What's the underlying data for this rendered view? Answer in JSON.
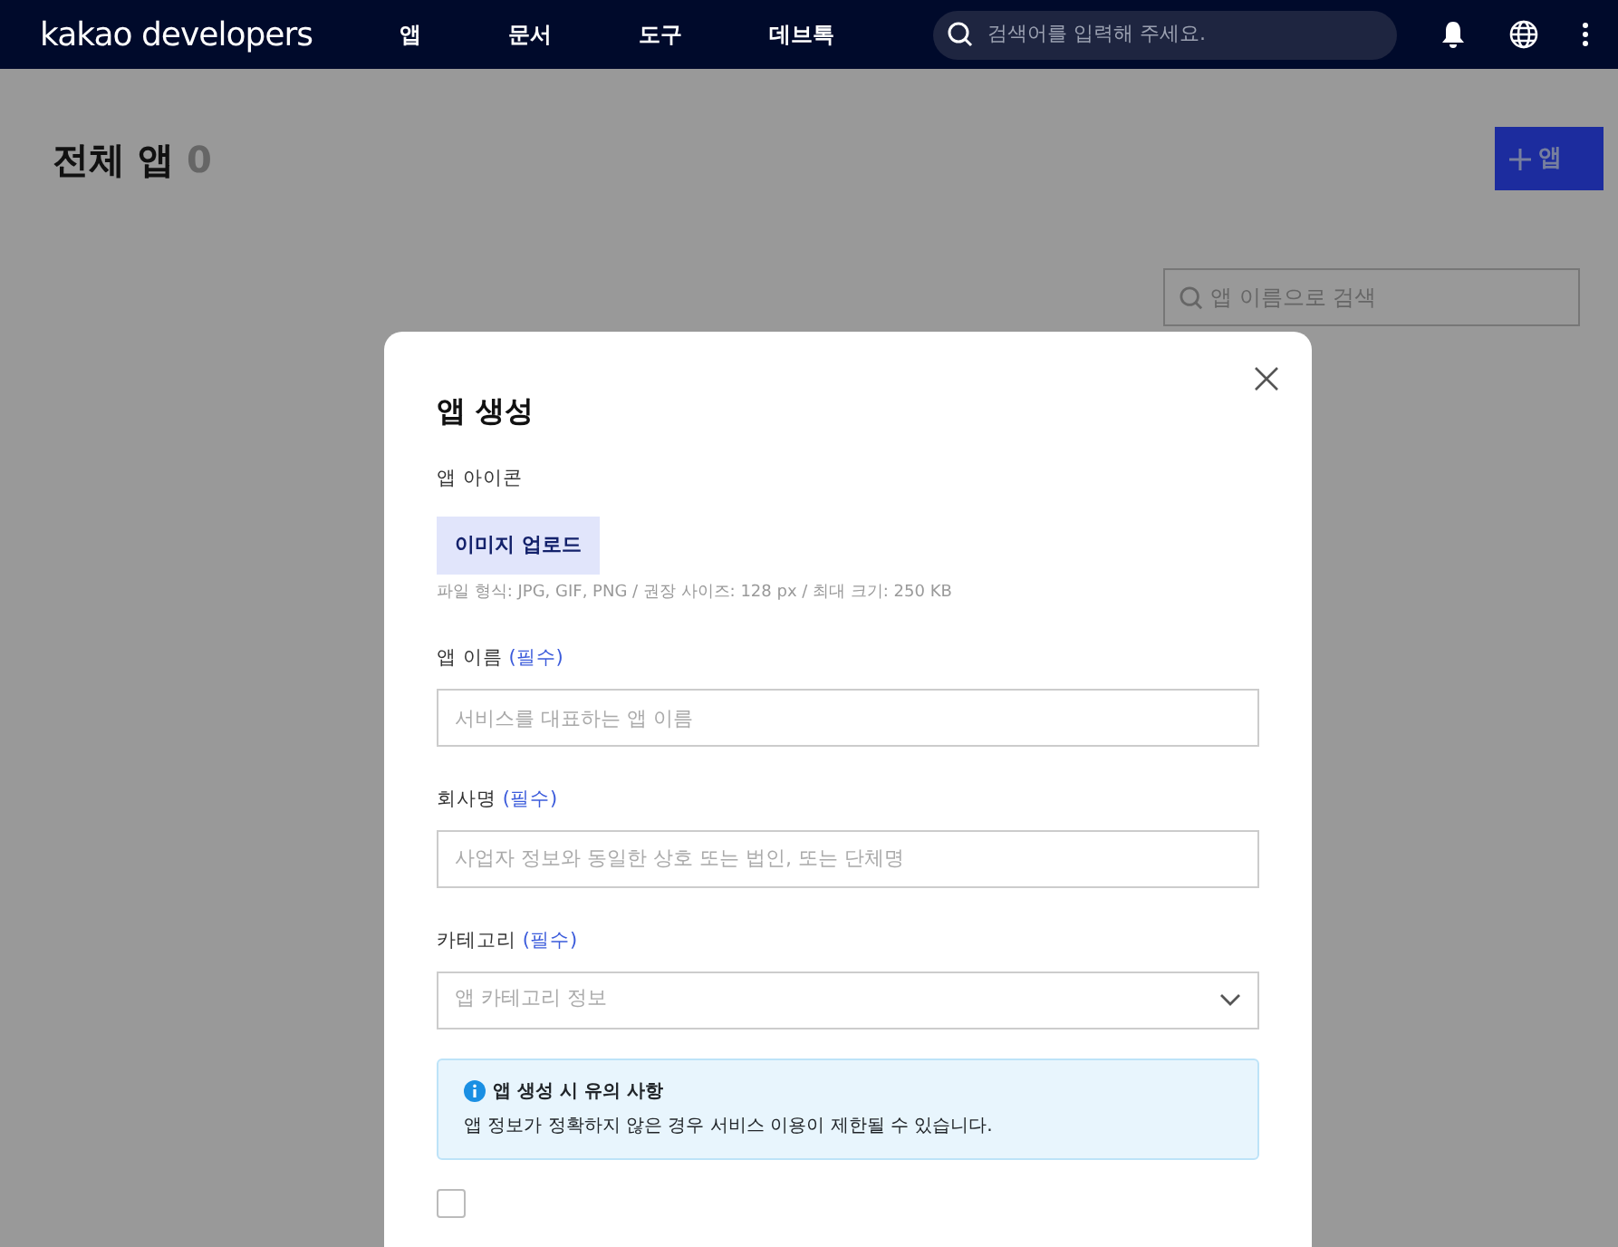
{
  "navbar": {
    "logo": "kakao developers",
    "menu": [
      {
        "label": "앱"
      },
      {
        "label": "문서"
      },
      {
        "label": "도구"
      },
      {
        "label": "데브톡"
      }
    ],
    "search": {
      "placeholder": "검색어를 입력해 주세요."
    }
  },
  "page": {
    "title": "전체 앱",
    "count": "0",
    "create_button": "앱",
    "search": {
      "placeholder": "앱 이름으로 검색"
    }
  },
  "modal": {
    "title": "앱 생성",
    "icon_label": "앱 아이콘",
    "upload_button": "이미지 업로드",
    "upload_hint": "파일 형식: JPG, GIF, PNG / 권장 사이즈: 128 px / 최대 크기: 250 KB",
    "fields": [
      {
        "kind": "text",
        "label": "앱 이름",
        "required": "(필수)",
        "placeholder": "서비스를 대표하는 앱 이름"
      },
      {
        "kind": "text",
        "label": "회사명",
        "required": "(필수)",
        "placeholder": "사업자 정보와 동일한 상호 또는 법인, 또는 단체명"
      },
      {
        "kind": "select",
        "label": "카테고리",
        "required": "(필수)",
        "placeholder": "앱 카테고리 정보"
      }
    ],
    "notice": {
      "title": "앱 생성 시 유의 사항",
      "text": "앱 정보가 정확하지 않은 경우 서비스 이용이 제한될 수 있습니다."
    },
    "agreement": {
      "checked": false
    }
  }
}
